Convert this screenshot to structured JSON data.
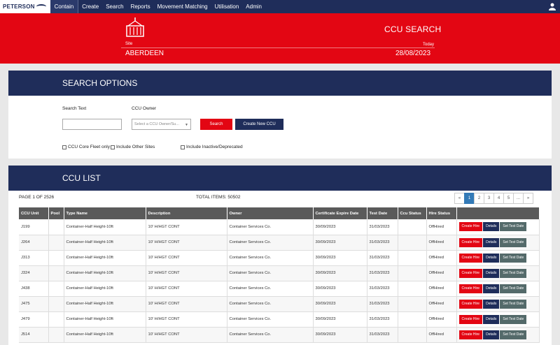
{
  "nav": {
    "logo": "PETERSON",
    "module": "Contain",
    "items": [
      "Create",
      "Search",
      "Reports",
      "Movement Matching",
      "Utilisation",
      "Admin"
    ]
  },
  "header": {
    "title": "CCU SEARCH",
    "site_label": "Site",
    "site_value": "ABERDEEN",
    "today_label": "Today",
    "today_value": "28/08/2023"
  },
  "search_options": {
    "title": "SEARCH OPTIONS",
    "search_text_label": "Search Text",
    "ccu_owner_label": "CCU Owner",
    "ccu_owner_placeholder": "Select a CCU Owner/Su...",
    "search_button": "Search",
    "create_button": "Create New CCU",
    "checkboxes": [
      "CCU Core Fleet only",
      "Include Other Sites",
      "Include Inactive/Deprecated"
    ]
  },
  "ccu_list": {
    "title": "CCU LIST",
    "page_info": "PAGE 1 OF 2526",
    "total_items": "TOTAL ITEMS: 50502",
    "pager": [
      "«",
      "1",
      "2",
      "3",
      "4",
      "5",
      "...",
      "»"
    ],
    "columns": [
      "CCU Unit",
      "Pool",
      "Type Name",
      "Description",
      "Owner",
      "Certificate Expire Date",
      "Test Date",
      "Ccu Status",
      "Hire Status",
      ""
    ],
    "actions": {
      "hire": "Create Hire",
      "details": "Details",
      "test": "Set Test Date"
    },
    "rows": [
      {
        "unit": "J199",
        "pool": "",
        "type": "Container-Half Height-10ft",
        "desc": "10' H/HGT CONT",
        "owner": "Container Services Co.",
        "cert": "30/09/2023",
        "test": "31/03/2023",
        "status": "",
        "hire": "OffHired"
      },
      {
        "unit": "J264",
        "pool": "",
        "type": "Container-Half Height-10ft",
        "desc": "10' H/HGT CONT",
        "owner": "Container Services Co.",
        "cert": "30/09/2023",
        "test": "31/03/2023",
        "status": "",
        "hire": "OffHired"
      },
      {
        "unit": "J313",
        "pool": "",
        "type": "Container-Half Height-10ft",
        "desc": "10' H/HGT CONT",
        "owner": "Container Services Co.",
        "cert": "30/09/2023",
        "test": "31/03/2023",
        "status": "",
        "hire": "OffHired"
      },
      {
        "unit": "J324",
        "pool": "",
        "type": "Container-Half Height-10ft",
        "desc": "10' H/HGT CONT",
        "owner": "Container Services Co.",
        "cert": "30/09/2023",
        "test": "31/03/2023",
        "status": "",
        "hire": "OffHired"
      },
      {
        "unit": "J438",
        "pool": "",
        "type": "Container-Half Height-10ft",
        "desc": "10' H/HGT CONT",
        "owner": "Container Services Co.",
        "cert": "30/09/2023",
        "test": "31/03/2023",
        "status": "",
        "hire": "OffHired"
      },
      {
        "unit": "J475",
        "pool": "",
        "type": "Container-Half Height-10ft",
        "desc": "10' H/HGT CONT",
        "owner": "Container Services Co.",
        "cert": "30/09/2023",
        "test": "31/03/2023",
        "status": "",
        "hire": "OffHired"
      },
      {
        "unit": "J479",
        "pool": "",
        "type": "Container-Half Height-10ft",
        "desc": "10' H/HGT CONT",
        "owner": "Container Services Co.",
        "cert": "30/09/2023",
        "test": "31/03/2023",
        "status": "",
        "hire": "OffHired"
      },
      {
        "unit": "J514",
        "pool": "",
        "type": "Container-Half Height-10ft",
        "desc": "10' H/HGT CONT",
        "owner": "Container Services Co.",
        "cert": "30/09/2023",
        "test": "31/03/2023",
        "status": "",
        "hire": "OffHired"
      }
    ]
  }
}
